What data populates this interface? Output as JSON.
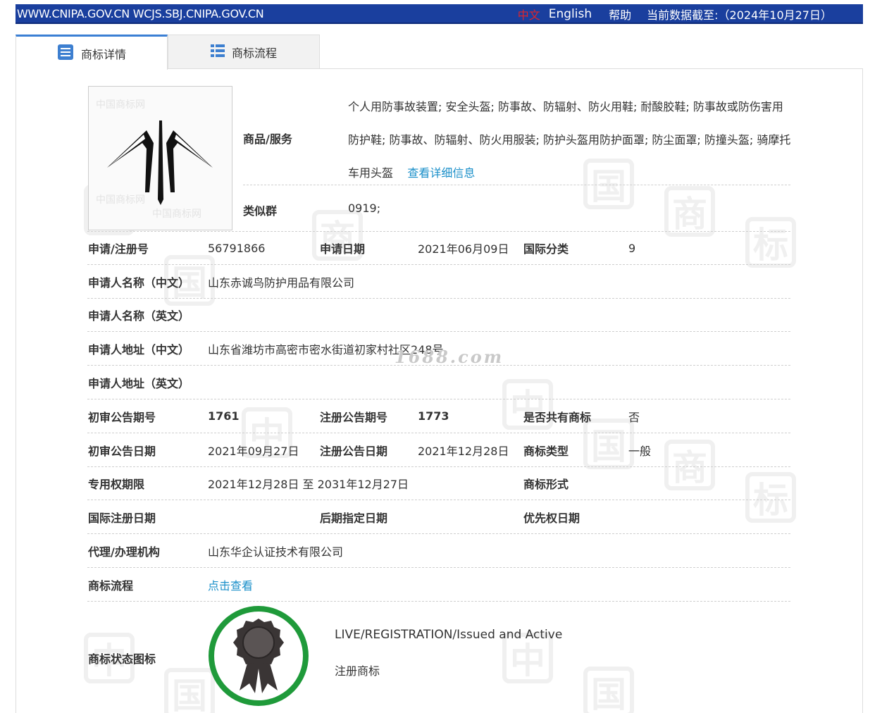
{
  "topbar": {
    "sites": "WWW.CNIPA.GOV.CN WCJS.SBJ.CNIPA.GOV.CN",
    "lang_zh": "中文",
    "lang_en": "English",
    "help": "帮助",
    "cutoff": "当前数据截至:（2024年10月27日）"
  },
  "tabs": [
    {
      "label": "商标详情",
      "icon": "document-list-icon",
      "active": true
    },
    {
      "label": "商标流程",
      "icon": "list-icon",
      "active": false
    }
  ],
  "colors": {
    "topbar": "#1a3f9e",
    "link": "#1a8fc9",
    "status_ring": "#1f9a3a",
    "lang_active": "#e0242a"
  },
  "watermark": "1688.com",
  "goods": {
    "label": "商品/服务",
    "text": "个人用防事故装置; 安全头盔; 防事故、防辐射、防火用鞋; 耐酸胶鞋; 防事故或防伤害用防护鞋; 防事故、防辐射、防火用服装; 防护头盔用防护面罩; 防尘面罩; 防撞头盔; 骑摩托车用头盔",
    "detail_link": "查看详细信息"
  },
  "similar_group": {
    "label": "类似群",
    "value": "0919;"
  },
  "fields": {
    "reg_no_label": "申请/注册号",
    "reg_no": "56791866",
    "apply_date_label": "申请日期",
    "apply_date": "2021年06月09日",
    "intl_class_label": "国际分类",
    "intl_class": "9",
    "applicant_cn_label": "申请人名称（中文）",
    "applicant_cn": "山东赤诚鸟防护用品有限公司",
    "applicant_en_label": "申请人名称（英文）",
    "applicant_en": "",
    "address_cn_label": "申请人地址（中文）",
    "address_cn": "山东省潍坊市高密市密水街道初家村社区248号",
    "address_en_label": "申请人地址（英文）",
    "address_en": "",
    "prelim_no_label": "初审公告期号",
    "prelim_no": "1761",
    "reg_pub_no_label": "注册公告期号",
    "reg_pub_no": "1773",
    "shared_label": "是否共有商标",
    "shared": "否",
    "prelim_date_label": "初审公告日期",
    "prelim_date": "2021年09月27日",
    "reg_pub_date_label": "注册公告日期",
    "reg_pub_date": "2021年12月28日",
    "tm_type_label": "商标类型",
    "tm_type": "一般",
    "exclusive_label": "专用权期限",
    "exclusive": "2021年12月28日 至 2031年12月27日",
    "tm_form_label": "商标形式",
    "tm_form": "",
    "intl_reg_date_label": "国际注册日期",
    "intl_reg_date": "",
    "later_date_label": "后期指定日期",
    "later_date": "",
    "priority_label": "优先权日期",
    "priority": "",
    "agent_label": "代理/办理机构",
    "agent": "山东华企认证技术有限公司",
    "process_label": "商标流程",
    "process_link": "点击查看",
    "status_label": "商标状态图标",
    "status_en": "LIVE/REGISTRATION/Issued and Active",
    "status_zh": "注册商标"
  }
}
